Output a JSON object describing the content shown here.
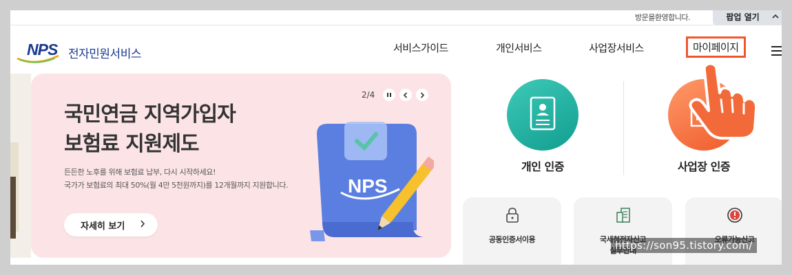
{
  "utility": {
    "welcome": "방문을환영합니다.",
    "popup_label": "팝업 열기",
    "popup_icon": "chevron-up-icon"
  },
  "logo": {
    "mark": "NPS",
    "title": "전자민원서비스"
  },
  "gnb": {
    "items": [
      {
        "label": "서비스가이드"
      },
      {
        "label": "개인서비스"
      },
      {
        "label": "사업장서비스"
      },
      {
        "label": "마이페이지"
      }
    ],
    "menu_icon": "hamburger-icon"
  },
  "banner": {
    "title_line1": "국민연금 지역가입자",
    "title_line2": "보험료 지원제도",
    "desc_line1": "든든한 노후를 위해 보험료 납부, 다시 시작하세요!",
    "desc_line2": "국가가 보험료의 최대 50%(월 4만 5천원까지)를 12개월까지 지원합니다.",
    "detail_label": "자세히 보기",
    "pager": "2/4",
    "illustration_text": "NPS"
  },
  "auth": {
    "personal_label": "개인 인증",
    "business_label": "사업장 인증"
  },
  "quick": {
    "items": [
      {
        "label": "공동인증서이용",
        "icon": "lock-icon"
      },
      {
        "label_line1": "국세청전자신고",
        "label_line2": "실무안내",
        "icon": "document-icon"
      },
      {
        "label": "오류가능신고",
        "icon": "alert-icon"
      }
    ]
  },
  "watermark": "https://son95.tistory.com/",
  "colors": {
    "brand_blue": "#1a3a8f",
    "highlight": "#f0552d",
    "personal_teal": "#2bb5a5",
    "business_orange": "#f26a3a",
    "banner_bg": "#fce4e6"
  }
}
